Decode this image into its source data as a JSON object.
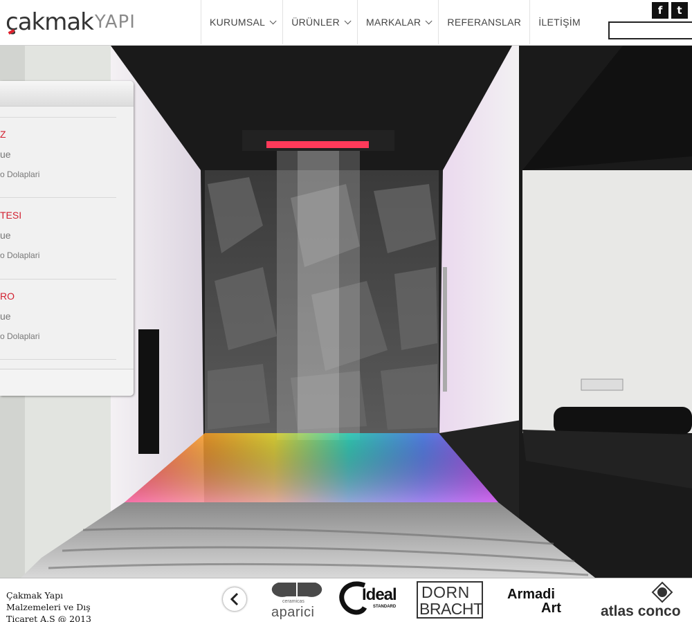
{
  "header": {
    "logo": {
      "part1": "çakmak",
      "part2": "YAPI"
    },
    "nav": [
      {
        "label": "KURUMSAL",
        "has_dropdown": true
      },
      {
        "label": "ÜRÜNLER",
        "has_dropdown": true
      },
      {
        "label": "MARKALAR",
        "has_dropdown": true
      },
      {
        "label": "REFERANSLAR",
        "has_dropdown": false
      },
      {
        "label": "İLETİŞİM",
        "has_dropdown": false
      }
    ],
    "social": {
      "facebook": "f",
      "twitter": "t"
    },
    "search": {
      "value": "",
      "placeholder": ""
    }
  },
  "panel": {
    "projects": [
      {
        "title": "Z",
        "line1": "ue",
        "line2": "o Dolaplari"
      },
      {
        "title": "TESI",
        "line1": "ue",
        "line2": "o Dolaplari"
      },
      {
        "title": "RO",
        "line1": "ue",
        "line2": "o Dolaplari"
      }
    ]
  },
  "footer": {
    "copyright": "Çakmak Yapı Malzemeleri ve Dış Ticaret A.Ş @ 2013",
    "brands": {
      "aparici_small": "ceramicas",
      "aparici": "aparici",
      "ideal": "Ideal",
      "ideal_small": "STANDARD",
      "dorn1": "DORN",
      "dorn2": "BRACHT",
      "armadi1": "Armadi",
      "armadi2": "Art",
      "atlas": "atlas conco"
    }
  },
  "colors": {
    "accent": "#d22030",
    "header_text": "#444444"
  }
}
